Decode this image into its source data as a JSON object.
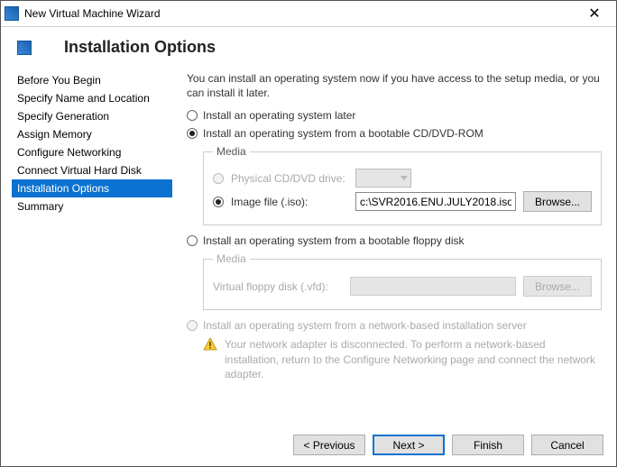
{
  "window": {
    "title": "New Virtual Machine Wizard"
  },
  "page": {
    "heading": "Installation Options"
  },
  "sidebar": {
    "items": [
      {
        "label": "Before You Begin"
      },
      {
        "label": "Specify Name and Location"
      },
      {
        "label": "Specify Generation"
      },
      {
        "label": "Assign Memory"
      },
      {
        "label": "Configure Networking"
      },
      {
        "label": "Connect Virtual Hard Disk"
      },
      {
        "label": "Installation Options"
      },
      {
        "label": "Summary"
      }
    ],
    "selected_index": 6
  },
  "intro": "You can install an operating system now if you have access to the setup media, or you can install it later.",
  "options": {
    "later": "Install an operating system later",
    "cd": "Install an operating system from a bootable CD/DVD-ROM",
    "floppy": "Install an operating system from a bootable floppy disk",
    "network": "Install an operating system from a network-based installation server"
  },
  "media": {
    "legend": "Media",
    "physical_label": "Physical CD/DVD drive:",
    "iso_label": "Image file (.iso):",
    "iso_value": "c:\\SVR2016.ENU.JULY2018.iso",
    "browse": "Browse...",
    "vfd_label": "Virtual floppy disk (.vfd):"
  },
  "network_warning": "Your network adapter is disconnected. To perform a network-based installation, return to the Configure Networking page and connect the network adapter.",
  "footer": {
    "previous": "< Previous",
    "next": "Next >",
    "finish": "Finish",
    "cancel": "Cancel"
  }
}
